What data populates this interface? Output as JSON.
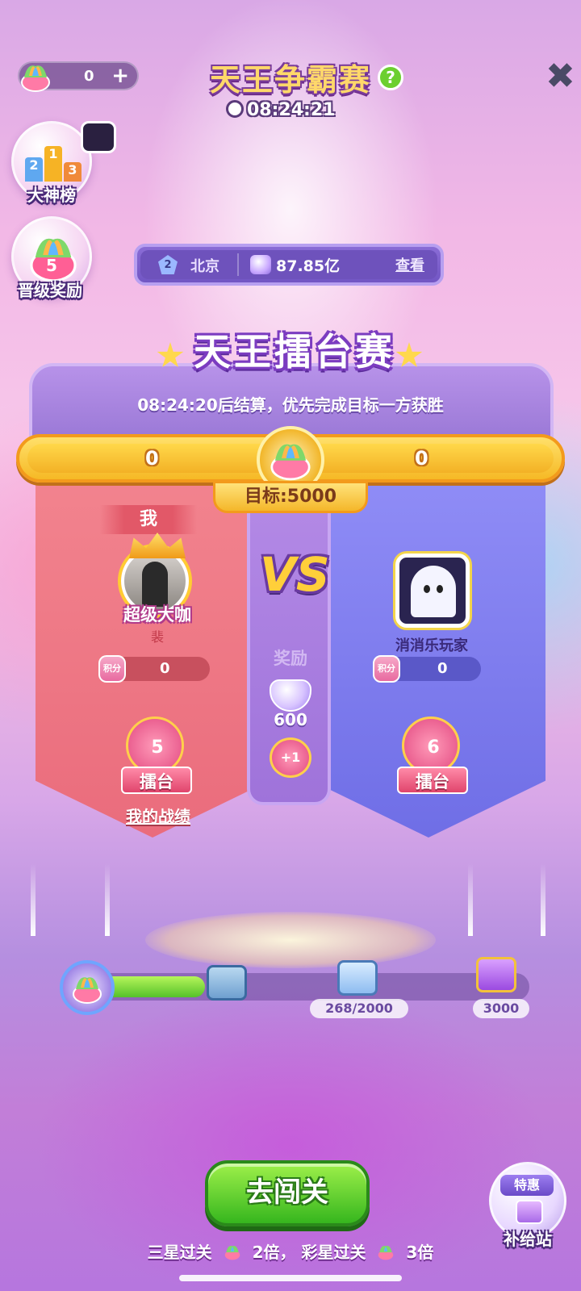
{
  "top": {
    "currency_value": "0",
    "plus_label": "+",
    "title": "天王争霸赛",
    "help_label": "?",
    "countdown": "08:24:21",
    "close_label": "✖"
  },
  "side": {
    "leaderboard_label": "大神榜",
    "podium": [
      "2",
      "1",
      "3"
    ],
    "levelup_count": "5",
    "levelup_label": "晋级奖励"
  },
  "location_bar": {
    "rank": "2",
    "city": "北京",
    "amount": "87.85亿",
    "view_label": "查看"
  },
  "arena": {
    "title": "天王擂台赛",
    "settle_text": "08:24:20后结算，优先完成目标一方获胜",
    "my_score": "0",
    "opponent_score": "0",
    "target_label": "目标:5000",
    "vs_label": "VS",
    "reward_label": "奖励",
    "reward_gems": "600",
    "reward_plus": "+1"
  },
  "me": {
    "label": "我",
    "title_badge": "超级大咖",
    "name": "裴",
    "points_icon": "积分",
    "points": "0",
    "arena_count": "5",
    "arena_label": "擂台",
    "record_label": "我的战绩"
  },
  "opponent": {
    "name": "消消乐玩家",
    "points_icon": "积分",
    "points": "0",
    "arena_count": "6",
    "arena_label": "擂台"
  },
  "progress": {
    "current": 268,
    "max": 3000,
    "chest_label": "268/2000",
    "final_label": "3000"
  },
  "bottom": {
    "go_label": "去闯关",
    "rule_part1": "三星过关",
    "rule_mult1": "2倍，",
    "rule_part2": "彩星过关",
    "rule_mult2": "3倍",
    "supply_tag": "特惠",
    "supply_label": "补给站"
  },
  "colors": {
    "accent_gold": "#ffd86a",
    "my_side": "#ea6c7c",
    "opponent_side": "#6f6ee6",
    "go_button": "#36b61e"
  },
  "icons": [
    "lotus-icon",
    "help-icon",
    "clock-icon",
    "close-icon",
    "podium-icon",
    "rank-icon",
    "heart-gem-icon",
    "star-icon",
    "crown-icon",
    "ghost-icon",
    "chest-icon",
    "gift-icon"
  ]
}
